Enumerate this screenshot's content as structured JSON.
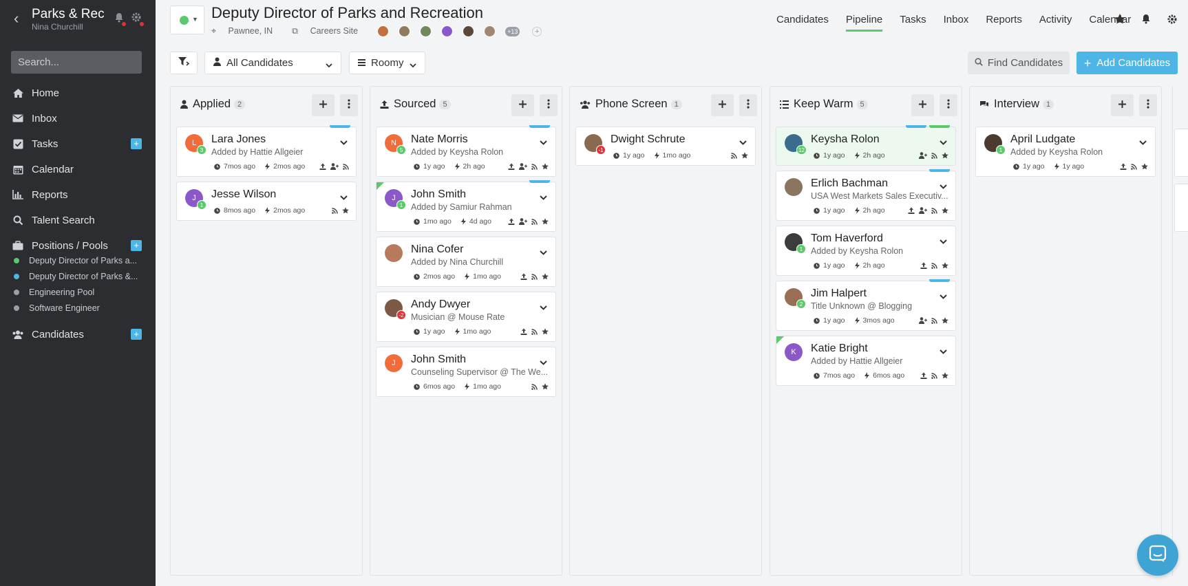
{
  "sidebar": {
    "org_name": "Parks & Rec",
    "user_name": "Nina Churchill",
    "search_placeholder": "Search...",
    "nav": [
      {
        "label": "Home",
        "icon": "home-icon"
      },
      {
        "label": "Inbox",
        "icon": "envelope-icon"
      },
      {
        "label": "Tasks",
        "icon": "checkbox-icon"
      },
      {
        "label": "Calendar",
        "icon": "calendar-icon"
      },
      {
        "label": "Reports",
        "icon": "bar-chart-icon"
      },
      {
        "label": "Talent Search",
        "icon": "search-icon"
      },
      {
        "label": "Positions / Pools",
        "icon": "briefcase-icon"
      },
      {
        "label": "Candidates",
        "icon": "users-icon"
      }
    ],
    "positions": [
      {
        "label": "Deputy Director of Parks a...",
        "color": "#5cc96b"
      },
      {
        "label": "Deputy Director of Parks &...",
        "color": "#4db6e6"
      },
      {
        "label": "Engineering Pool",
        "color": "#9aa0a6"
      },
      {
        "label": "Software Engineer",
        "color": "#9aa0a6"
      }
    ]
  },
  "header": {
    "job_title": "Deputy Director of Parks and Recreation",
    "location": "Pawnee, IN",
    "careers_site": "Careers Site",
    "more_collaborators": "+13",
    "nav": [
      "Candidates",
      "Pipeline",
      "Tasks",
      "Inbox",
      "Reports",
      "Activity",
      "Calendar"
    ],
    "active_nav": "Pipeline"
  },
  "toolbar": {
    "filter_select": "All Candidates",
    "view_select": "Roomy",
    "find_label": "Find Candidates",
    "add_label": "Add Candidates"
  },
  "columns": [
    {
      "title": "Applied",
      "count": "2",
      "icon": "user-icon",
      "cards": [
        {
          "name": "Lara Jones",
          "sub": "Added by Hattie Allgeier",
          "avatar_letter": "L",
          "avatar_color": "#f26b3a",
          "badge": "3",
          "t1": "7mos ago",
          "t2": "2mos ago"
        },
        {
          "name": "Jesse Wilson",
          "sub": "",
          "avatar_letter": "J",
          "avatar_color": "#8a58c9",
          "badge": "1",
          "t1": "8mos ago",
          "t2": "2mos ago"
        }
      ]
    },
    {
      "title": "Sourced",
      "count": "5",
      "icon": "upload-icon",
      "cards": [
        {
          "name": "Nate Morris",
          "sub": "Added by Keysha Rolon",
          "avatar_letter": "N",
          "avatar_color": "#f26b3a",
          "badge": "5",
          "t1": "1y ago",
          "t2": "2h ago"
        },
        {
          "name": "John Smith",
          "sub": "Added by Samiur Rahman",
          "avatar_letter": "J",
          "avatar_color": "#8a58c9",
          "badge": "1",
          "t1": "1mo ago",
          "t2": "4d ago"
        },
        {
          "name": "Nina Cofer",
          "sub": "Added by Nina Churchill",
          "avatar_letter": "",
          "avatar_color": "#b77a5c",
          "badge": "",
          "t1": "2mos ago",
          "t2": "1mo ago"
        },
        {
          "name": "Andy Dwyer",
          "sub": "Musician @ Mouse Rate",
          "avatar_letter": "",
          "avatar_color": "#7b5a45",
          "badge": "-2",
          "t1": "1y ago",
          "t2": "1mo ago"
        },
        {
          "name": "John Smith",
          "sub": "Counseling Supervisor @ The We...",
          "avatar_letter": "J",
          "avatar_color": "#f26b3a",
          "badge": "",
          "t1": "6mos ago",
          "t2": "1mo ago"
        }
      ]
    },
    {
      "title": "Phone Screen",
      "count": "1",
      "icon": "users-icon",
      "cards": [
        {
          "name": "Dwight Schrute",
          "sub": "",
          "avatar_letter": "",
          "avatar_color": "#8a6a4e",
          "badge": "-1",
          "t1": "1y ago",
          "t2": "1mo ago"
        }
      ]
    },
    {
      "title": "Keep Warm",
      "count": "5",
      "icon": "list-icon",
      "cards": [
        {
          "name": "Keysha Rolon",
          "sub": "",
          "avatar_letter": "",
          "avatar_color": "#3a6c8e",
          "badge": "12",
          "t1": "1y ago",
          "t2": "2h ago"
        },
        {
          "name": "Erlich Bachman",
          "sub": "USA West Markets Sales Executiv...",
          "avatar_letter": "",
          "avatar_color": "#8a7560",
          "badge": "",
          "t1": "1y ago",
          "t2": "2h ago"
        },
        {
          "name": "Tom Haverford",
          "sub": "Added by Keysha Rolon",
          "avatar_letter": "",
          "avatar_color": "#3c3c3c",
          "badge": "1",
          "t1": "1y ago",
          "t2": "2h ago"
        },
        {
          "name": "Jim Halpert",
          "sub": "Title Unknown @ Blogging",
          "avatar_letter": "",
          "avatar_color": "#9a6e52",
          "badge": "2",
          "t1": "1y ago",
          "t2": "3mos ago"
        },
        {
          "name": "Katie Bright",
          "sub": "Added by Hattie Allgeier",
          "avatar_letter": "K",
          "avatar_color": "#8a58c9",
          "badge": "",
          "t1": "7mos ago",
          "t2": "6mos ago"
        }
      ]
    },
    {
      "title": "Interview",
      "count": "1",
      "icon": "chat-icon",
      "cards": [
        {
          "name": "April Ludgate",
          "sub": "Added by Keysha Rolon",
          "avatar_letter": "",
          "avatar_color": "#4a3a30",
          "badge": "1",
          "t1": "1y ago",
          "t2": "1y ago"
        }
      ]
    }
  ],
  "colors": {
    "accent": "#4db6e6",
    "success": "#5cc96b",
    "danger": "#e0323a",
    "sidebar_bg": "#2b2d30"
  }
}
